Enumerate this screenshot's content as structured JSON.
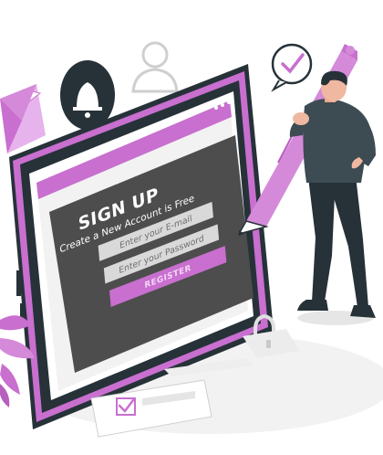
{
  "form": {
    "title": "SIGN UP",
    "subtitle": "Create a New Account is Free",
    "email_placeholder": "Enter your E-mail",
    "password_placeholder": "Enter your Password",
    "register_label": "REGISTER"
  },
  "icons": [
    "bell-icon",
    "user-icon",
    "envelope-icon",
    "checkmark-icon",
    "padlock-icon",
    "checkbox-icon",
    "pen-icon"
  ],
  "colors": {
    "accent": "#c86fcf",
    "accent_light": "#e7b3ec",
    "dark": "#263238",
    "screen": "#4d4d4d"
  }
}
